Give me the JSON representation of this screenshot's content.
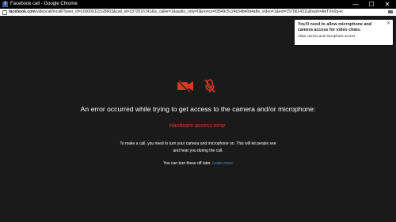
{
  "window": {
    "title": "Facebook call - Google Chrome",
    "fb_icon": "f",
    "controls": [
      "—",
      "☐",
      "✕"
    ]
  },
  "address": {
    "domain": "facebook.com",
    "path": "/videocall/incall/?peer_id=100000111528603&call_id=3372516741&is_caller=1&audio_only=0&nonce=f2849c5c24b54b40d4a8e_video=1&ext=1570614311&hash=AeTXo6q-kc"
  },
  "messages": {
    "error": "An error occurred while trying to get access to the camera and/or microphone:",
    "hardware": "Hardware access error.",
    "para1": "To make a call, you need to turn your camera and microphone on. This will let people see and hear you during the call.",
    "later": "You can turn these off later.",
    "learn_more": "Learn more"
  },
  "popup": {
    "title": "You'll need to allow microphone and camera access for video chats.",
    "subtitle": "Allow camera and microphone access",
    "close": "✕"
  },
  "colors": {
    "error_red": "#d93a25",
    "link_blue": "#4a90e2",
    "background": "#1a1a1a"
  },
  "icons": [
    "camera-off-icon",
    "microphone-off-icon",
    "lock-icon",
    "camera-icon"
  ]
}
